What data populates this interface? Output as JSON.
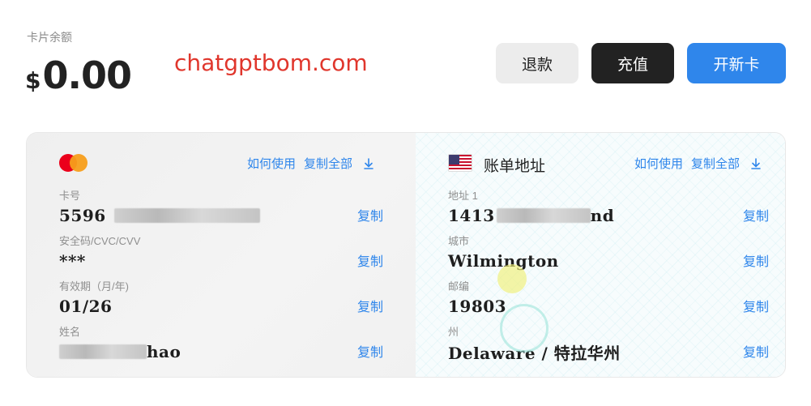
{
  "balance": {
    "label": "卡片余额",
    "currency": "$",
    "amount": "0.00"
  },
  "watermark": "chatgptbom.com",
  "actions": {
    "refund": "退款",
    "topup": "充值",
    "new_card": "开新卡"
  },
  "card": {
    "brand_icon": "mastercard-logo",
    "links": {
      "how_to_use": "如何使用",
      "copy_all": "复制全部"
    },
    "fields": [
      {
        "label": "卡号",
        "value_prefix": "5596",
        "copy": "复制"
      },
      {
        "label": "安全码/CVC/CVV",
        "value": "***",
        "copy": "复制"
      },
      {
        "label": "有效期（月/年)",
        "value": "01/26",
        "copy": "复制"
      },
      {
        "label": "姓名",
        "value_suffix": "hao",
        "copy": "复制"
      }
    ]
  },
  "billing": {
    "flag_icon": "us-flag-icon",
    "title": "账单地址",
    "links": {
      "how_to_use": "如何使用",
      "copy_all": "复制全部"
    },
    "fields": [
      {
        "label": "地址 1",
        "value_prefix": "1413",
        "value_suffix": "nd",
        "copy": "复制"
      },
      {
        "label": "城市",
        "value": "Wilmington",
        "copy": "复制"
      },
      {
        "label": "邮编",
        "value": "19803",
        "copy": "复制"
      },
      {
        "label": "州",
        "value": "Delaware / 特拉华州",
        "copy": "复制"
      }
    ]
  },
  "colors": {
    "accent": "#2f86eb",
    "dark_button": "#222222",
    "watermark": "#e0362c"
  }
}
